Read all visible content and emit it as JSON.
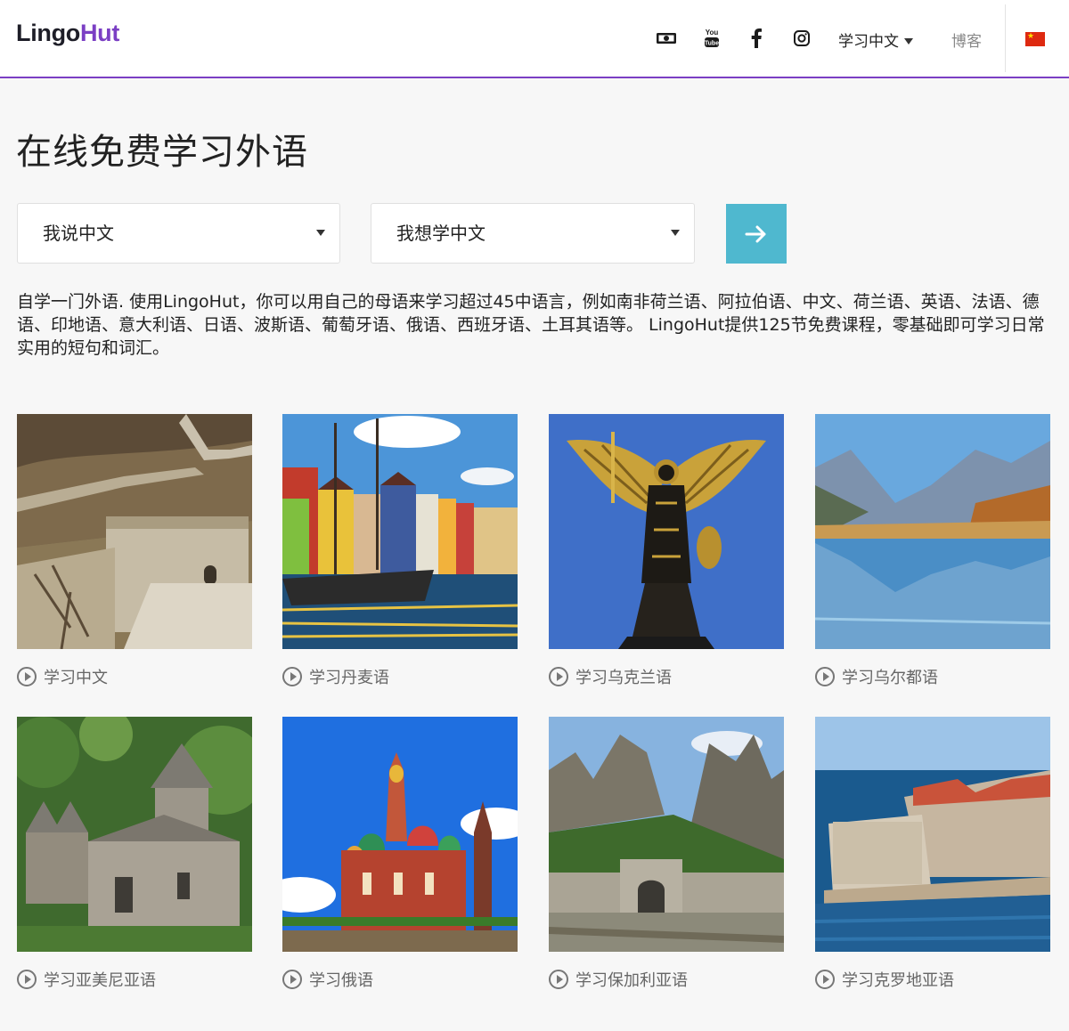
{
  "header": {
    "logo_part1": "Lingo",
    "logo_part2": "Hut",
    "icons": [
      "money-icon",
      "youtube-icon",
      "facebook-icon",
      "instagram-icon"
    ],
    "language_menu": "学习中文",
    "blog": "博客",
    "flag": "china-flag",
    "colors": {
      "accent": "#7b3fc4",
      "button": "#4fb8cf"
    }
  },
  "main": {
    "title": "在线免费学习外语",
    "speak_select": "我说中文",
    "learn_select": "我想学中文",
    "intro": "自学一门外语. 使用LingoHut，你可以用自己的母语来学习超过45中语言，例如南非荷兰语、阿拉伯语、中文、荷兰语、英语、法语、德语、印地语、意大利语、日语、波斯语、葡萄牙语、俄语、西班牙语、土耳其语等。 LingoHut提供125节免费课程，零基础即可学习日常实用的短句和词汇。"
  },
  "languages": [
    {
      "label": "学习中文",
      "image": "great-wall-photo"
    },
    {
      "label": "学习丹麦语",
      "image": "copenhagen-harbor-photo"
    },
    {
      "label": "学习乌克兰语",
      "image": "golden-angel-statue-photo"
    },
    {
      "label": "学习乌尔都语",
      "image": "mountain-lake-photo"
    },
    {
      "label": "学习亚美尼亚语",
      "image": "armenian-monastery-photo"
    },
    {
      "label": "学习俄语",
      "image": "st-basils-cathedral-photo"
    },
    {
      "label": "学习保加利亚语",
      "image": "rock-fortress-photo"
    },
    {
      "label": "学习克罗地亚语",
      "image": "dubrovnik-photo"
    }
  ]
}
